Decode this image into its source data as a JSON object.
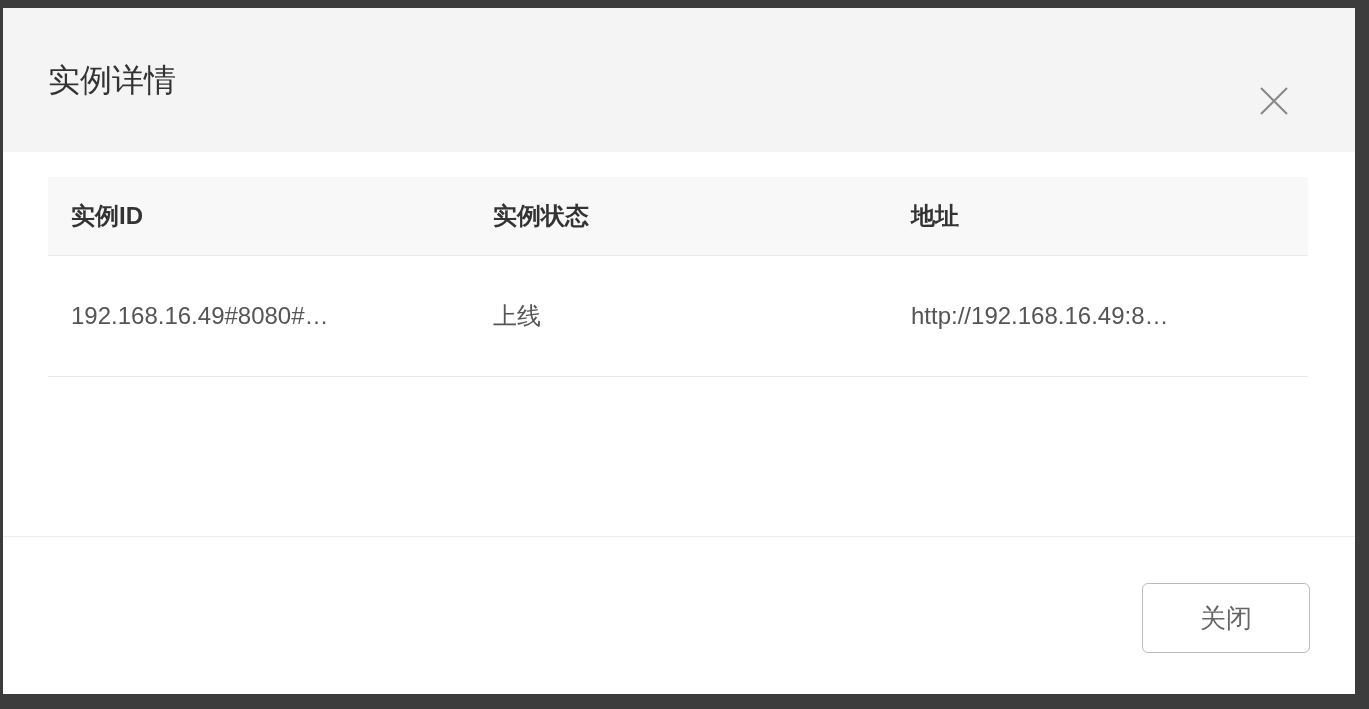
{
  "dialog": {
    "title": "实例详情",
    "table": {
      "columns": [
        "实例ID",
        "实例状态",
        "地址"
      ],
      "rows": [
        [
          "192.168.16.49#8080#…",
          "上线",
          "http://192.168.16.49:8…"
        ]
      ]
    },
    "buttons": [
      "关闭"
    ]
  }
}
